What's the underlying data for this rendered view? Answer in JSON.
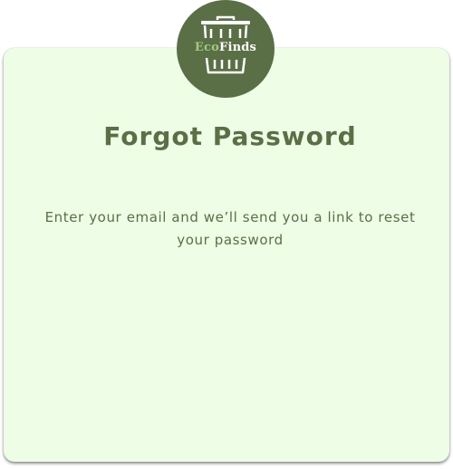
{
  "logo": {
    "icon": "trash-can-icon",
    "text_part1": "Eco",
    "text_part2": "Finds"
  },
  "page": {
    "title": "Forgot Password",
    "description": "Enter your email and we’ll send you a link to reset your password"
  },
  "colors": {
    "card_background": "#edfde6",
    "brand_green": "#5b6f46",
    "logo_accent": "#a6c77f"
  }
}
